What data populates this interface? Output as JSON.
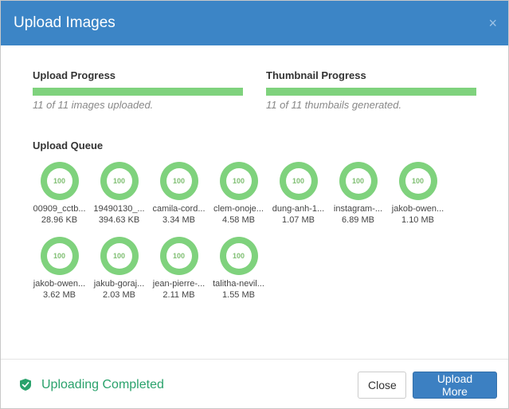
{
  "dialog": {
    "title": "Upload Images",
    "close_symbol": "×"
  },
  "upload_progress": {
    "label": "Upload Progress",
    "fraction": 1.0,
    "text": "11 of 11 images uploaded."
  },
  "thumbnail_progress": {
    "label": "Thumbnail Progress",
    "fraction": 1.0,
    "text": "11 of 11 thumbails generated."
  },
  "queue": {
    "label": "Upload Queue",
    "items": [
      {
        "name": "00909_cctb...",
        "size": "28.96 KB",
        "percent": "100"
      },
      {
        "name": "19490130_...",
        "size": "394.63 KB",
        "percent": "100"
      },
      {
        "name": "camila-cord...",
        "size": "3.34 MB",
        "percent": "100"
      },
      {
        "name": "clem-onoje...",
        "size": "4.58 MB",
        "percent": "100"
      },
      {
        "name": "dung-anh-1...",
        "size": "1.07 MB",
        "percent": "100"
      },
      {
        "name": "instagram-...",
        "size": "6.89 MB",
        "percent": "100"
      },
      {
        "name": "jakob-owen...",
        "size": "1.10 MB",
        "percent": "100"
      },
      {
        "name": "jakob-owen...",
        "size": "3.62 MB",
        "percent": "100"
      },
      {
        "name": "jakub-goraj...",
        "size": "2.03 MB",
        "percent": "100"
      },
      {
        "name": "jean-pierre-...",
        "size": "2.11 MB",
        "percent": "100"
      },
      {
        "name": "talitha-nevil...",
        "size": "1.55 MB",
        "percent": "100"
      }
    ]
  },
  "footer": {
    "status_text": "Uploading Completed",
    "close_label": "Close",
    "upload_more_label": "Upload More"
  },
  "colors": {
    "header": "#3c85c6",
    "progress": "#7fd27d",
    "success": "#2aa26c",
    "primary_button": "#3c80c2"
  },
  "icons": {
    "status": "check-shield-icon",
    "close": "close-icon"
  }
}
